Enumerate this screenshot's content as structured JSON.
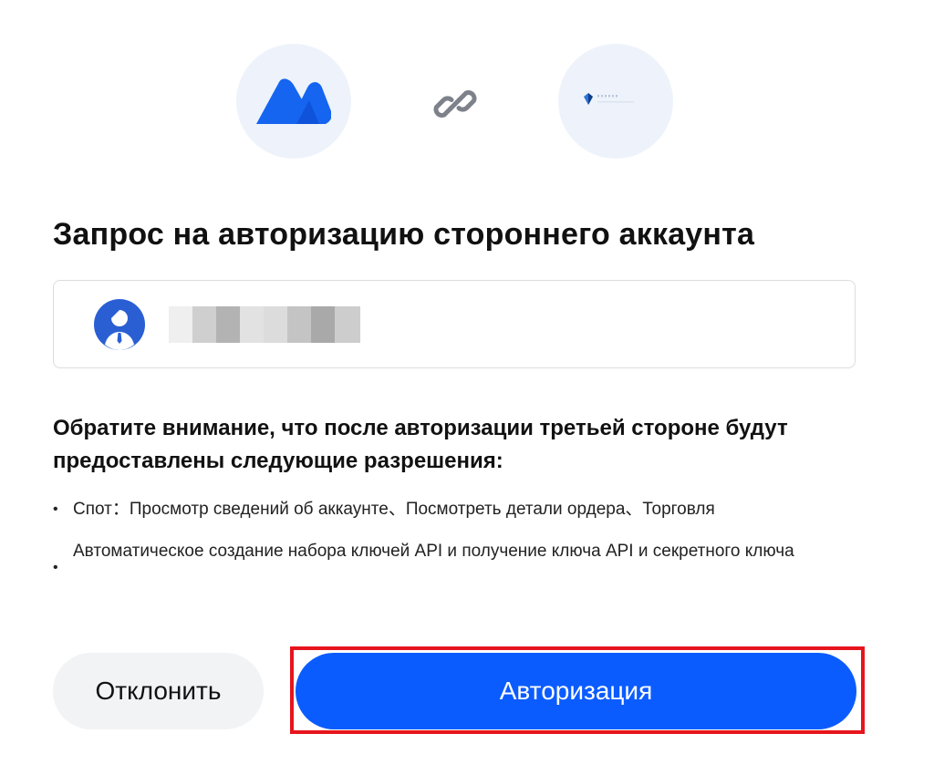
{
  "header": {
    "left_logo_icon": "mexc-logo-icon",
    "link_icon": "link-icon",
    "right_logo_icon": "crypto-app-logo-icon"
  },
  "title": "Запрос на авторизацию стороннего аккаунта",
  "account": {
    "avatar_icon": "user-avatar-icon",
    "name_redacted": true
  },
  "notice": "Обратите внимание, что после авторизации третьей стороне будут предоставлены следующие разрешения:",
  "permissions": [
    {
      "bullet": "•",
      "text": "Спот：Просмотр сведений об аккаунте、Посмотреть детали ордера、Торговля"
    },
    {
      "bullet": "•",
      "text": "Автоматическое создание набора ключей API и получение ключа API и секретного ключа"
    }
  ],
  "buttons": {
    "decline_label": "Отклонить",
    "authorize_label": "Авторизация"
  },
  "colors": {
    "primary": "#0b5cff",
    "highlight": "#e6151d",
    "logo_bg": "#eef3fb",
    "decline_bg": "#f2f3f5"
  }
}
